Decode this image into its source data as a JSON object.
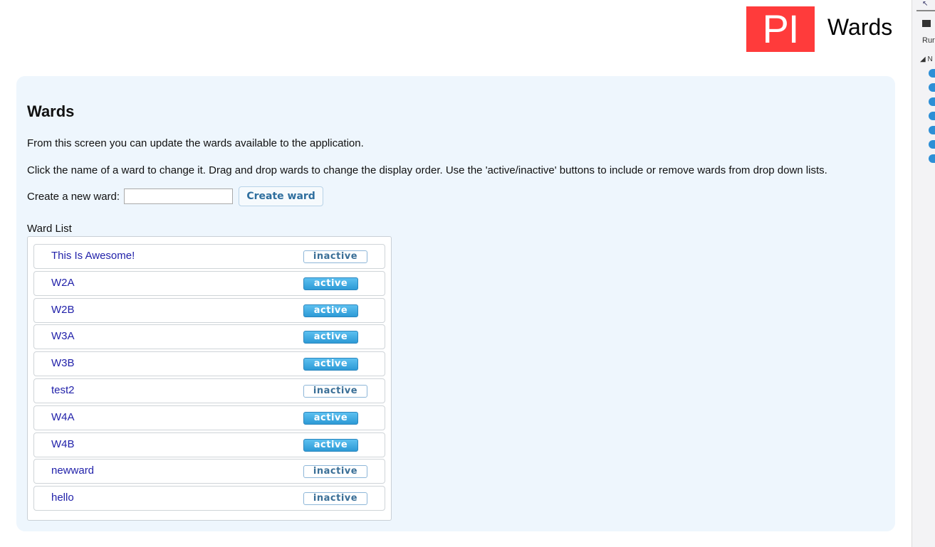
{
  "header": {
    "logo_text": "PI",
    "title": "Wards"
  },
  "page": {
    "title": "Wards",
    "description_1": "From this screen you can update the wards available to the application.",
    "description_2": "Click the name of a ward to change it. Drag and drop wards to change the display order. Use the 'active/inactive' buttons to include or remove wards from drop down lists.",
    "create_label": "Create a new ward:",
    "create_input_value": "",
    "create_button_label": "Create ward",
    "list_label": "Ward List"
  },
  "wards": [
    {
      "name": "This Is Awesome!",
      "status": "inactive"
    },
    {
      "name": "W2A",
      "status": "active"
    },
    {
      "name": "W2B",
      "status": "active"
    },
    {
      "name": "W3A",
      "status": "active"
    },
    {
      "name": "W3B",
      "status": "active"
    },
    {
      "name": "test2",
      "status": "inactive"
    },
    {
      "name": "W4A",
      "status": "active"
    },
    {
      "name": "W4B",
      "status": "active"
    },
    {
      "name": "newward",
      "status": "inactive"
    },
    {
      "name": "hello",
      "status": "inactive"
    }
  ],
  "side_strip": {
    "text": "Rur",
    "tri": "◢ N"
  },
  "colors": {
    "logo_bg": "#ff3b3b",
    "panel_bg": "#eef6fd",
    "link": "#2222aa",
    "active_btn": "#2d9ad6"
  }
}
